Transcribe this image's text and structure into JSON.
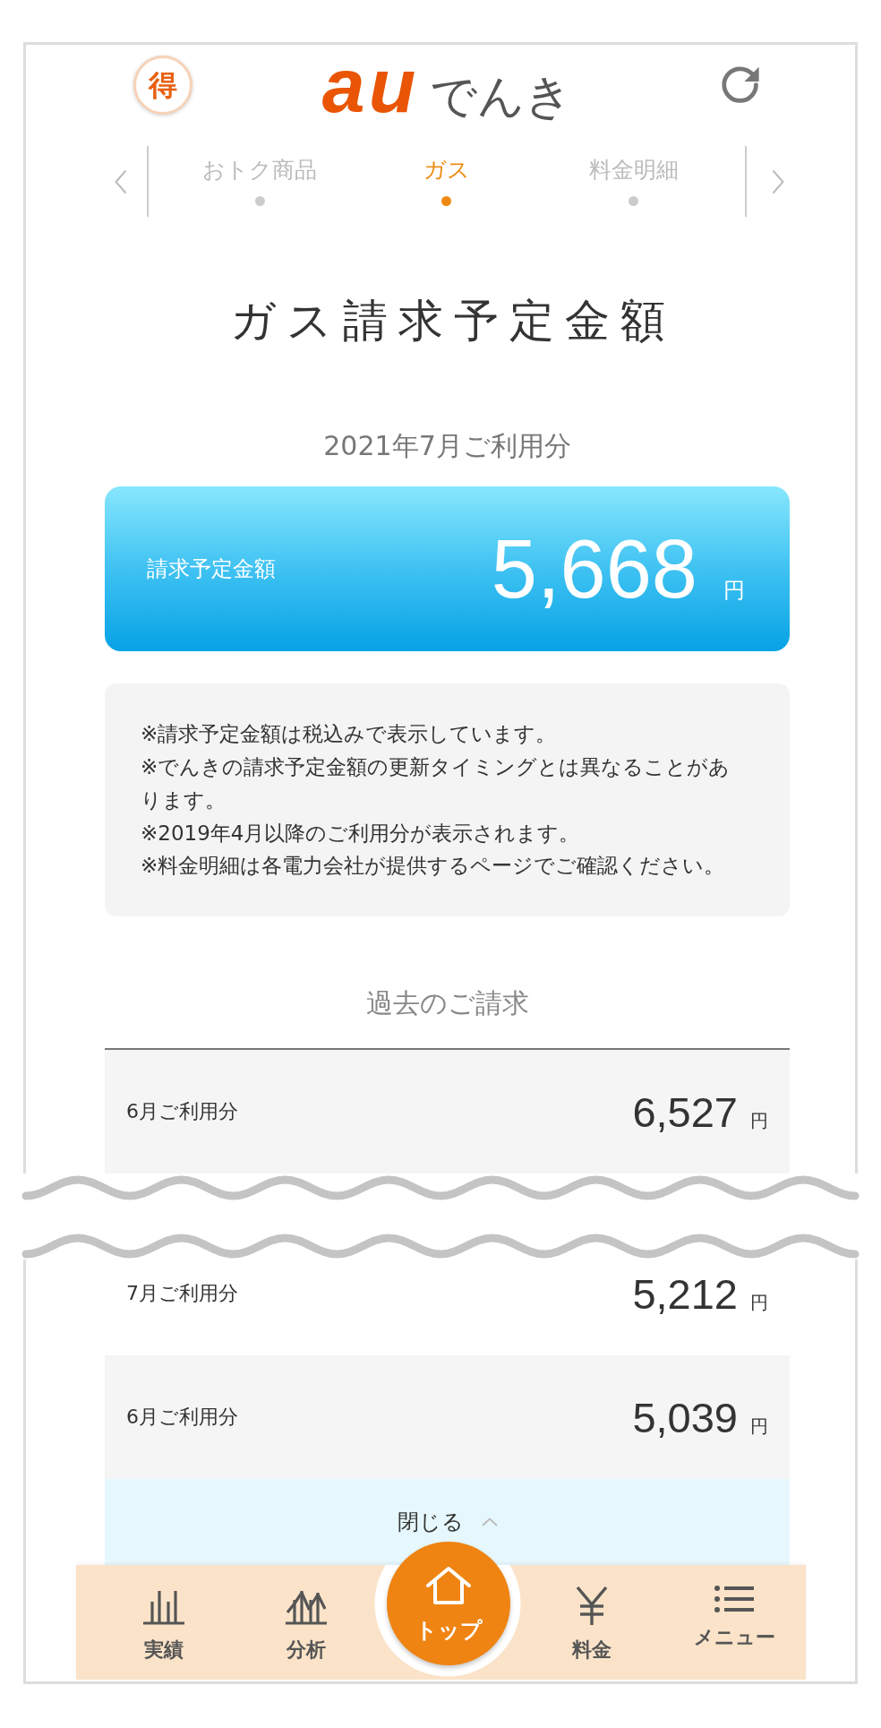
{
  "header": {
    "badge": "得",
    "logo": {
      "mark": "au",
      "name": "でんき"
    }
  },
  "tabs": [
    {
      "label": "おトク商品",
      "selected": false
    },
    {
      "label": "ガス",
      "selected": true
    },
    {
      "label": "料金明細",
      "selected": false
    }
  ],
  "page_title": "ガス請求予定金額",
  "billing_period": "2021年7月ご利用分",
  "amount_card": {
    "label": "請求予定金額",
    "amount": "5,668",
    "unit": "円"
  },
  "notes": [
    "※請求予定金額は税込みで表示しています。",
    "※でんきの請求予定金額の更新タイミングとは異なることがあります。",
    "※2019年4月以降のご利用分が表示されます。",
    "※料金明細は各電力会社が提供するページでご確認ください。"
  ],
  "past_billing": {
    "title": "過去のご請求",
    "rows": [
      {
        "month": "6月ご利用分",
        "amount": "6,527",
        "unit": "円"
      }
    ]
  },
  "past_billing_after_break": {
    "rows": [
      {
        "month": "7月ご利用分",
        "amount": "5,212",
        "unit": "円"
      },
      {
        "month": "6月ご利用分",
        "amount": "5,039",
        "unit": "円"
      }
    ],
    "close_button": "閉じる"
  },
  "bottom_nav": [
    {
      "label": "実績",
      "kind": "tab"
    },
    {
      "label": "分析",
      "kind": "tab"
    },
    {
      "label": "トップ",
      "kind": "home"
    },
    {
      "label": "料金",
      "kind": "tab"
    },
    {
      "label": "メニュー",
      "kind": "tab"
    }
  ]
}
